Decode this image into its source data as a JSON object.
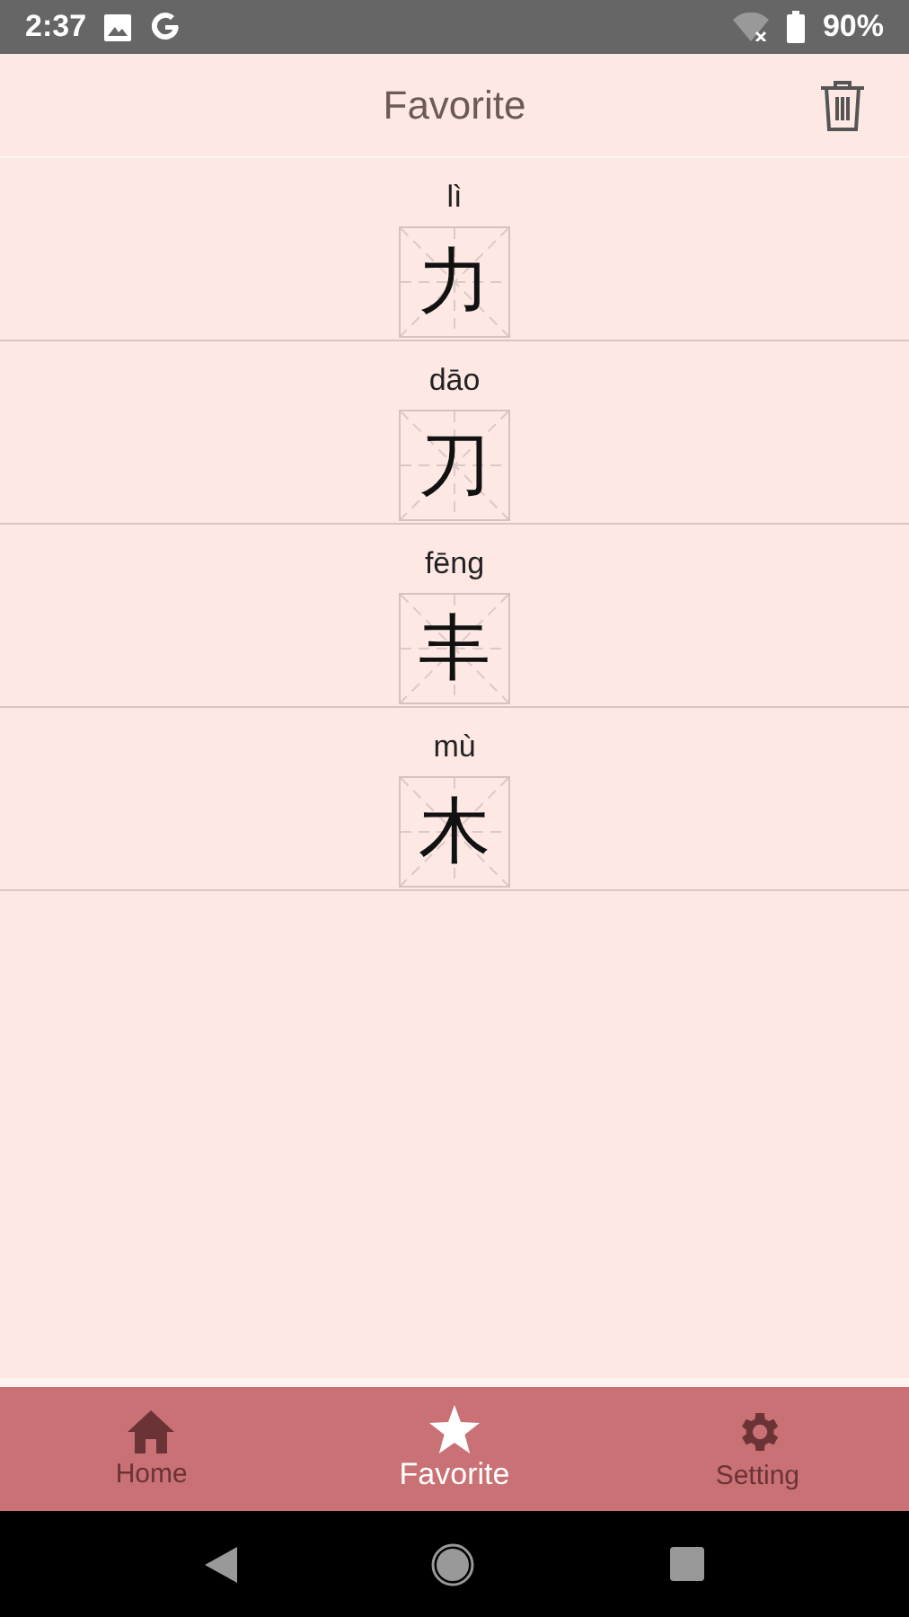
{
  "status_bar": {
    "time": "2:37",
    "battery": "90%"
  },
  "header": {
    "title": "Favorite"
  },
  "favorites": [
    {
      "pinyin": "lì",
      "character": "力"
    },
    {
      "pinyin": "dāo",
      "character": "刀"
    },
    {
      "pinyin": "fēng",
      "character": "丰"
    },
    {
      "pinyin": "mù",
      "character": "木"
    }
  ],
  "bottom_nav": [
    {
      "label": "Home",
      "selected": false
    },
    {
      "label": "Favorite",
      "selected": true
    },
    {
      "label": "Setting",
      "selected": false
    }
  ]
}
